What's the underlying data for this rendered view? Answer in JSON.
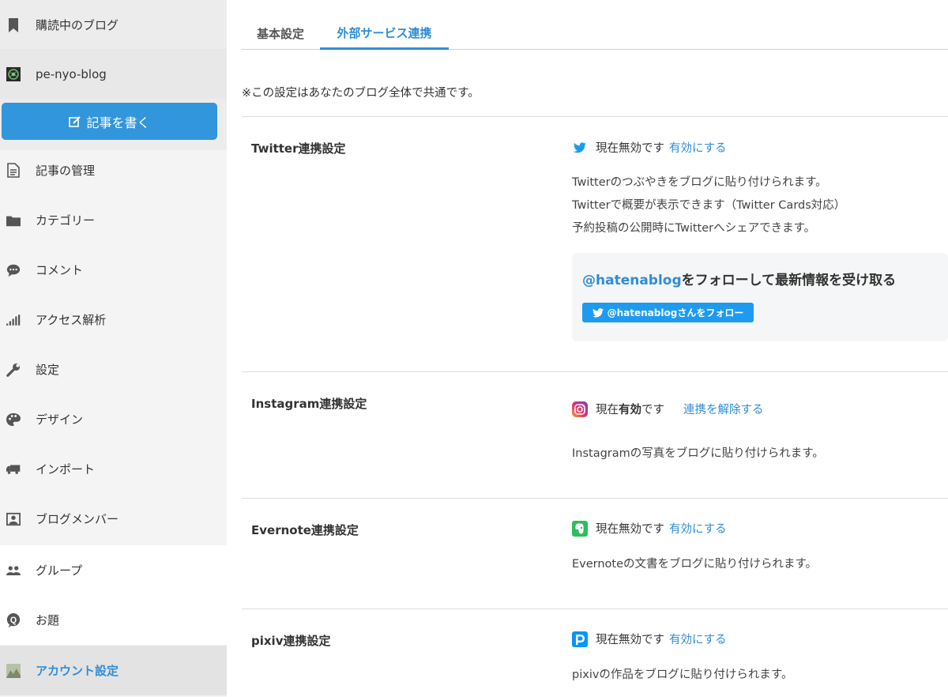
{
  "sidebar": {
    "items": [
      {
        "label": "購読中のブログ",
        "icon": "bookmark-icon"
      },
      {
        "label": "pe-nyo-blog",
        "icon": "blog-avatar"
      },
      {
        "label": "記事の管理",
        "icon": "document-icon"
      },
      {
        "label": "カテゴリー",
        "icon": "folder-icon"
      },
      {
        "label": "コメント",
        "icon": "comment-icon"
      },
      {
        "label": "アクセス解析",
        "icon": "bar-chart-icon"
      },
      {
        "label": "設定",
        "icon": "wrench-icon"
      },
      {
        "label": "デザイン",
        "icon": "palette-icon"
      },
      {
        "label": "インポート",
        "icon": "truck-icon"
      },
      {
        "label": "ブログメンバー",
        "icon": "member-icon"
      },
      {
        "label": "グループ",
        "icon": "group-icon"
      },
      {
        "label": "お題",
        "icon": "q-badge-icon"
      },
      {
        "label": "アカウント設定",
        "icon": "account-avatar"
      }
    ],
    "write_button": "記事を書く"
  },
  "tabs": [
    {
      "label": "基本設定",
      "active": false
    },
    {
      "label": "外部サービス連携",
      "active": true
    }
  ],
  "note": "※この設定はあなたのブログ全体で共通です。",
  "sections": {
    "twitter": {
      "title": "Twitter連携設定",
      "status": "現在無効です",
      "action": "有効にする",
      "desc": [
        "Twitterのつぶやきをブログに貼り付けられます。",
        "Twitterで概要が表示できます（Twitter Cards対応）",
        "予約投稿の公開時にTwitterへシェアできます。"
      ],
      "follow_handle": "@hatenablog",
      "follow_text": "をフォローして最新情報を受け取る",
      "follow_button": "@hatenablogさんをフォロー"
    },
    "instagram": {
      "title": "Instagram連携設定",
      "status_prefix": "現在",
      "status_strong": "有効",
      "status_suffix": "です",
      "action": "連携を解除する",
      "desc": "Instagramの写真をブログに貼り付けられます。"
    },
    "evernote": {
      "title": "Evernote連携設定",
      "status": "現在無効です",
      "action": "有効にする",
      "desc": "Evernoteの文書をブログに貼り付けられます。"
    },
    "pixiv": {
      "title": "pixiv連携設定",
      "status": "現在無効です",
      "action": "有効にする",
      "desc": "pixivの作品をブログに貼り付けられます。"
    }
  },
  "colors": {
    "accent": "#2f8dd6",
    "write_button": "#3296dc",
    "twitter": "#1d9bf0"
  }
}
